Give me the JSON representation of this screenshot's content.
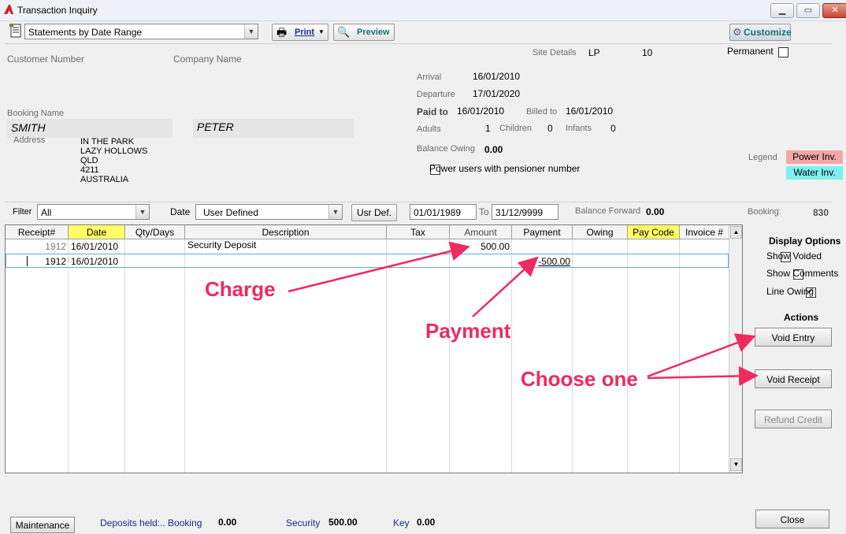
{
  "window": {
    "title": "Transaction Inquiry"
  },
  "toolbar": {
    "report_select": "Statements by Date Range",
    "print_label": "Print",
    "preview_label": "Preview",
    "customize_label": "Customize"
  },
  "header": {
    "customer_number_label": "Customer Number",
    "company_name_label": "Company Name",
    "site_details_label": "Site Details",
    "site_code": "LP",
    "site_number": "10",
    "permanent_label": "Permanent",
    "booking_name_label": "Booking Name",
    "surname": "SMITH",
    "firstname": "PETER",
    "address_label": "Address",
    "address_lines": [
      "IN THE PARK",
      "LAZY HOLLOWS",
      "QLD",
      "4211",
      "AUSTRALIA"
    ],
    "arrival_label": "Arrival",
    "arrival": "16/01/2010",
    "departure_label": "Departure",
    "departure": "17/01/2020",
    "paid_to_label": "Paid to",
    "paid_to": "16/01/2010",
    "billed_to_label": "Billed to",
    "billed_to": "16/01/2010",
    "adults_label": "Adults",
    "adults": "1",
    "children_label": "Children",
    "children": "0",
    "infants_label": "Infants",
    "infants": "0",
    "balance_owing_label": "Balance Owing",
    "balance_owing": "0.00",
    "power_users_label": "Power users with pensioner number",
    "legend_label": "Legend",
    "legend_power": "Power Inv.",
    "legend_water": "Water Inv.",
    "legend_power_color": "#f4a6a6",
    "legend_water_color": "#7ff0f0"
  },
  "filter": {
    "filter_label": "Filter",
    "filter_value": "All",
    "date_label": "Date",
    "date_value": "User Defined",
    "usr_def_label": "Usr Def.",
    "from_date": "01/01/1989",
    "to_label": "To",
    "to_date": "31/12/9999",
    "balance_forward_label": "Balance Forward",
    "balance_forward": "0.00",
    "booking_label": "Booking:",
    "booking_number": "830"
  },
  "grid": {
    "columns": [
      "Receipt#",
      "Date",
      "Qty/Days",
      "Description",
      "Tax",
      "Amount",
      "Payment",
      "Owing",
      "Pay Code",
      "Invoice #"
    ],
    "rows": [
      {
        "receipt": "1912",
        "date": "16/01/2010",
        "qty": "",
        "description": "Security Deposit",
        "tax": "",
        "amount": "500.00",
        "payment": "",
        "owing": "",
        "paycode": "",
        "invoice": ""
      },
      {
        "receipt": "1912",
        "date": "16/01/2010",
        "qty": "",
        "description": "",
        "tax": "",
        "amount": "",
        "payment": "-500.00",
        "owing": "",
        "paycode": "",
        "invoice": ""
      }
    ]
  },
  "display_options": {
    "title": "Display Options",
    "show_voided": "Show Voided",
    "show_comments": "Show  Comments",
    "line_owing": "Line Owing"
  },
  "actions": {
    "title": "Actions",
    "void_entry": "Void Entry",
    "void_receipt": "Void Receipt",
    "refund_credit": "Refund Credit"
  },
  "annotations": {
    "charge": "Charge",
    "payment": "Payment",
    "choose_one": "Choose one"
  },
  "footer": {
    "maintenance_label": "Maintenance",
    "deposits_label": "Deposits held:.. Booking",
    "deposits_booking": "0.00",
    "security_label": "Security",
    "security_value": "500.00",
    "key_label": "Key",
    "key_value": "0.00",
    "close_label": "Close"
  }
}
